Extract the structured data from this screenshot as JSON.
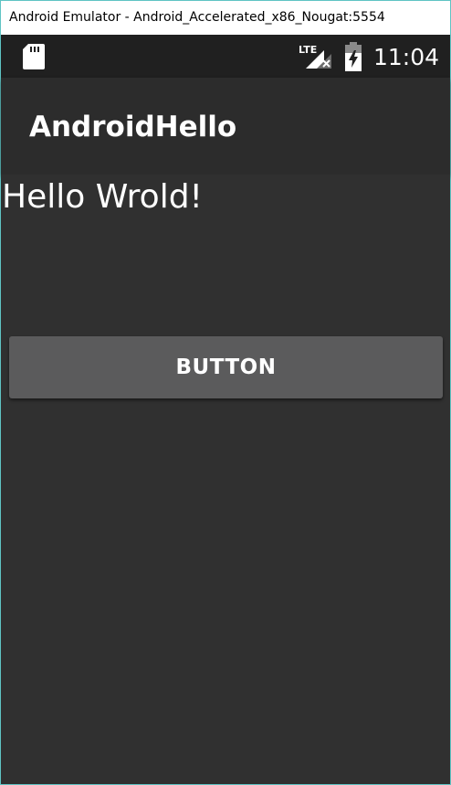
{
  "window": {
    "title": "Android Emulator - Android_Accelerated_x86_Nougat:5554"
  },
  "status_bar": {
    "icons": [
      "sd-card-icon",
      "lte-signal-icon",
      "battery-charging-icon"
    ],
    "network_label": "LTE",
    "time": "11:04"
  },
  "app_bar": {
    "title": "AndroidHello"
  },
  "main": {
    "greeting": "Hello Wrold!",
    "button_label": "BUTTON"
  },
  "colors": {
    "status_bar_bg": "#202020",
    "app_bar_bg": "#2c2c2c",
    "content_bg": "#303030",
    "button_bg": "#5b5b5c",
    "text": "#ffffff"
  }
}
